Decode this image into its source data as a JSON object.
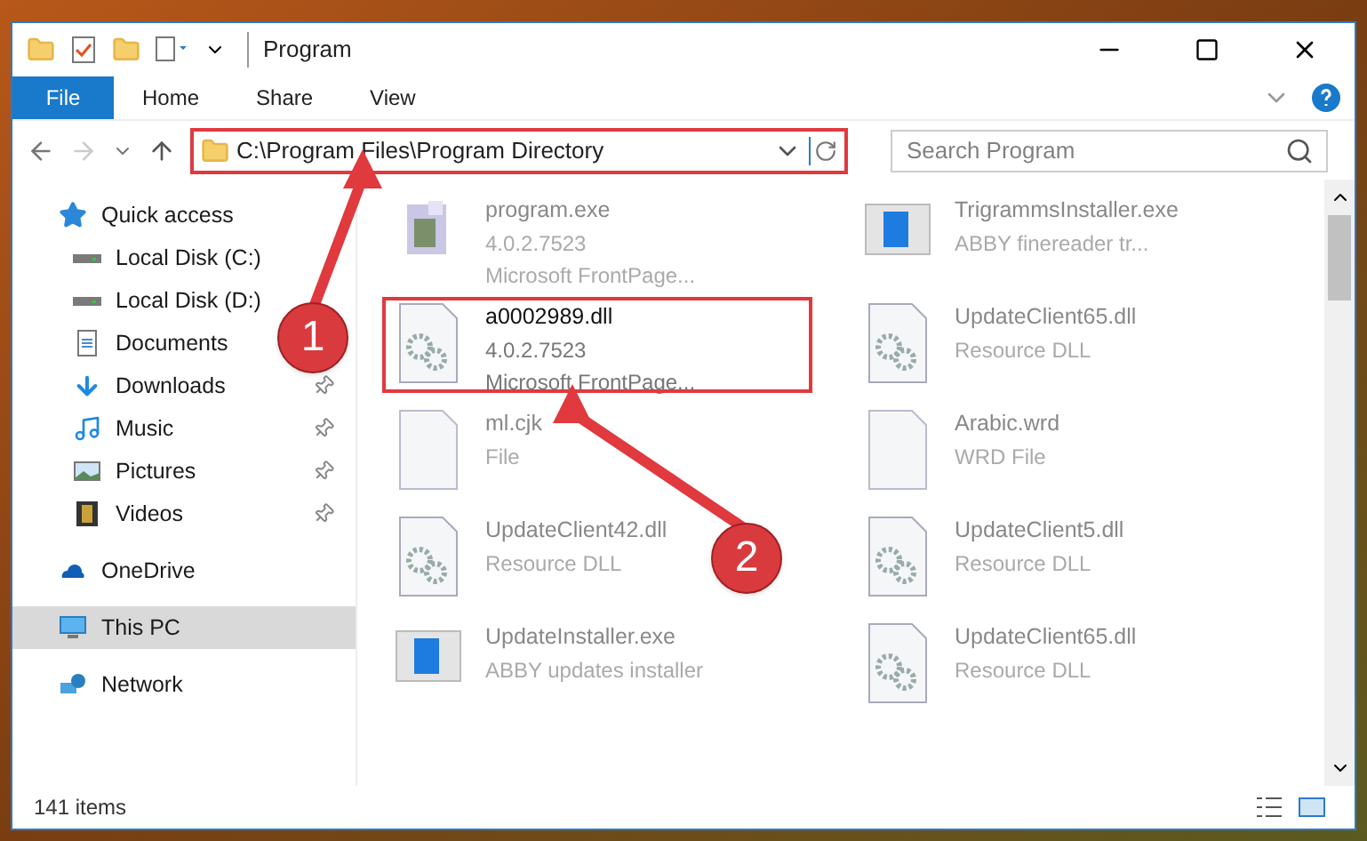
{
  "window": {
    "title": "Program"
  },
  "ribbon_tabs": [
    {
      "label": "File",
      "selected": true
    },
    {
      "label": "Home",
      "selected": false
    },
    {
      "label": "Share",
      "selected": false
    },
    {
      "label": "View",
      "selected": false
    }
  ],
  "address_bar": {
    "path": "C:\\Program Files\\Program Directory"
  },
  "search": {
    "placeholder": "Search Program"
  },
  "sidebar": {
    "items": [
      {
        "label": "Quick access",
        "selected": false,
        "children": [
          {
            "label": "Local Disk (C:)",
            "pinned": false,
            "selected": false
          },
          {
            "label": "Local Disk (D:)",
            "pinned": false,
            "selected": false
          },
          {
            "label": "Documents",
            "pinned": false,
            "selected": false
          },
          {
            "label": "Downloads",
            "pinned": true,
            "selected": false
          },
          {
            "label": "Music",
            "pinned": true,
            "selected": false
          },
          {
            "label": "Pictures",
            "pinned": true,
            "selected": false
          },
          {
            "label": "Videos",
            "pinned": true,
            "selected": false
          }
        ]
      },
      {
        "label": "OneDrive",
        "selected": false
      },
      {
        "label": "This PC",
        "selected": true
      },
      {
        "label": "Network",
        "selected": false
      }
    ]
  },
  "files": [
    {
      "name": "program.exe",
      "details": [
        "4.0.2.7523",
        "Microsoft FrontPage..."
      ],
      "kind": "exe",
      "highlighted": false
    },
    {
      "name": "TrigrammsInstaller.exe",
      "details": [
        "ABBY finereader tr..."
      ],
      "kind": "installer",
      "highlighted": false
    },
    {
      "name": "a0002989.dll",
      "details": [
        "4.0.2.7523",
        "Microsoft FrontPage..."
      ],
      "kind": "dll",
      "highlighted": true
    },
    {
      "name": "UpdateClient65.dll",
      "details": [
        "Resource DLL"
      ],
      "kind": "dll",
      "highlighted": false
    },
    {
      "name": "ml.cjk",
      "details": [
        "File"
      ],
      "kind": "blank",
      "highlighted": false
    },
    {
      "name": "Arabic.wrd",
      "details": [
        "WRD File"
      ],
      "kind": "blank",
      "highlighted": false
    },
    {
      "name": "UpdateClient42.dll",
      "details": [
        "Resource DLL"
      ],
      "kind": "dll",
      "highlighted": false
    },
    {
      "name": "UpdateClient5.dll",
      "details": [
        "Resource DLL"
      ],
      "kind": "dll",
      "highlighted": false
    },
    {
      "name": "UpdateInstaller.exe",
      "details": [
        "ABBY updates installer"
      ],
      "kind": "installer",
      "highlighted": false
    },
    {
      "name": "UpdateClient65.dll",
      "details": [
        "Resource DLL"
      ],
      "kind": "dll",
      "highlighted": false
    }
  ],
  "status_bar": {
    "item_count": "141 items"
  },
  "annotations": [
    {
      "number": "1"
    },
    {
      "number": "2"
    }
  ]
}
